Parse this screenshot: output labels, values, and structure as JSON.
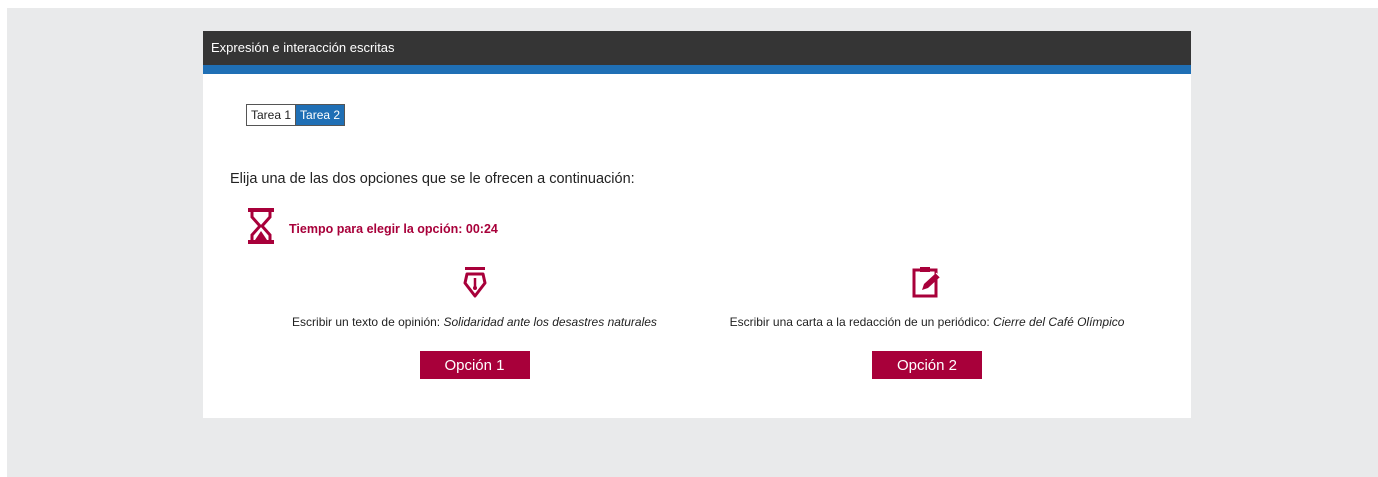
{
  "header": {
    "title": "Expresión e interacción escritas"
  },
  "tabs": [
    {
      "label": "Tarea 1",
      "active": false
    },
    {
      "label": "Tarea 2",
      "active": true
    }
  ],
  "instruction": "Elija una de las dos opciones que se le ofrecen a continuación:",
  "timer": {
    "icon": "hourglass-icon",
    "label": "Tiempo para elegir la opción: 00:24"
  },
  "options": [
    {
      "icon": "fountain-pen-icon",
      "prefix": "Escribir un texto de opinión: ",
      "topic": "Solidaridad ante los desastres naturales",
      "button": "Opción 1"
    },
    {
      "icon": "clipboard-edit-icon",
      "prefix": "Escribir una carta a la redacción de un periódico: ",
      "topic": "Cierre del Café Olímpico",
      "button": "Opción 2"
    }
  ],
  "colors": {
    "accent": "#a8003a",
    "blue": "#1f6fb5",
    "header": "#353535",
    "background": "#e9eaeb"
  }
}
